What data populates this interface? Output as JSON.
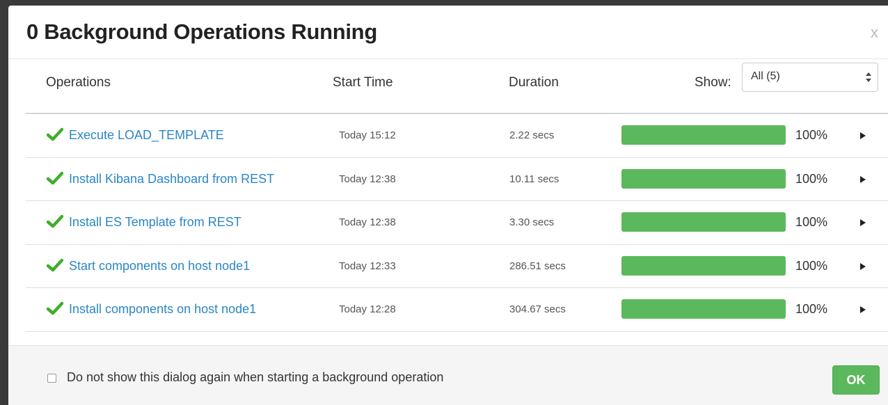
{
  "modal": {
    "title": "0 Background Operations Running",
    "close_label": "x"
  },
  "table": {
    "headers": {
      "operations": "Operations",
      "start_time": "Start Time",
      "duration": "Duration"
    },
    "filter": {
      "label": "Show:",
      "selected": "All (5)"
    },
    "rows": [
      {
        "name": "Execute LOAD_TEMPLATE",
        "start": "Today 15:12",
        "duration": "2.22 secs",
        "progress": 100,
        "percent_label": "100%",
        "status_icon": "check-icon"
      },
      {
        "name": "Install Kibana Dashboard from REST",
        "start": "Today 12:38",
        "duration": "10.11 secs",
        "progress": 100,
        "percent_label": "100%",
        "status_icon": "check-icon"
      },
      {
        "name": "Install ES Template from REST",
        "start": "Today 12:38",
        "duration": "3.30 secs",
        "progress": 100,
        "percent_label": "100%",
        "status_icon": "check-icon"
      },
      {
        "name": "Start components on host node1",
        "start": "Today 12:33",
        "duration": "286.51 secs",
        "progress": 100,
        "percent_label": "100%",
        "status_icon": "check-icon"
      },
      {
        "name": "Install components on host node1",
        "start": "Today 12:28",
        "duration": "304.67 secs",
        "progress": 100,
        "percent_label": "100%",
        "status_icon": "check-icon"
      }
    ]
  },
  "footer": {
    "dont_show_label": "Do not show this dialog again when starting a background operation",
    "dont_show_checked": false,
    "ok_label": "OK"
  },
  "colors": {
    "link": "#2a86c8",
    "success": "#5cb85c",
    "check": "#3fae29"
  }
}
